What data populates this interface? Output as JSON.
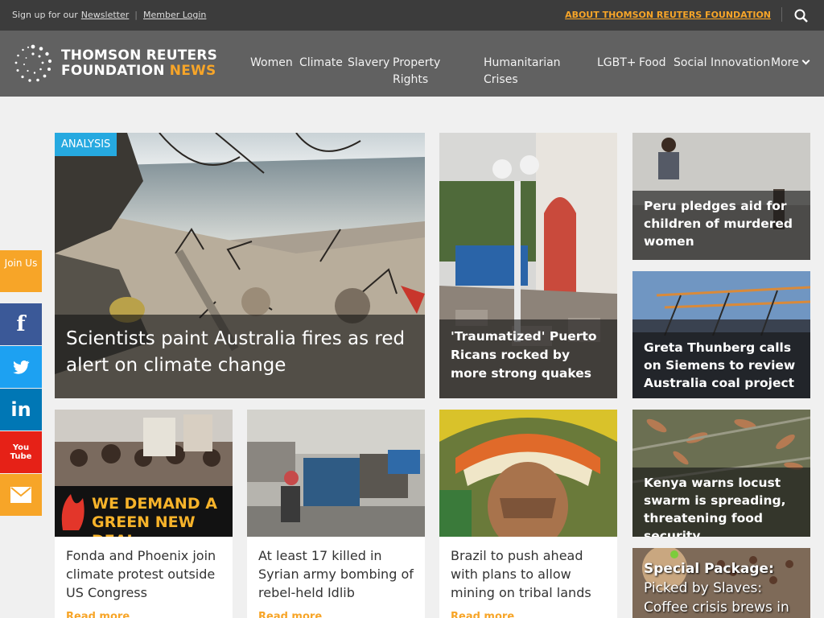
{
  "topbar": {
    "signup_text": "Sign up for our",
    "newsletter": "Newsletter",
    "member_login": "Member Login",
    "about": "ABOUT THOMSON REUTERS FOUNDATION"
  },
  "header": {
    "logo_line1": "THOMSON REUTERS",
    "logo_line2": "FOUNDATION",
    "logo_news": "NEWS",
    "nav": {
      "women": "Women",
      "climate": "Climate",
      "slavery": "Slavery",
      "property_rights": "Property Rights",
      "humanitarian": "Humanitarian Crises",
      "lgbt": "LGBT+",
      "food": "Food",
      "social_innovation": "Social Innovation",
      "more": "More"
    }
  },
  "hero": {
    "badge": "ANALYSIS",
    "title": "Scientists paint Australia fires as red alert on climate change"
  },
  "stories": {
    "puerto_rico": "'Traumatized' Puerto Ricans rocked by more strong quakes",
    "peru": "Peru pledges aid for children of murdered women",
    "greta": "Greta Thunberg calls on Siemens to review Australia coal project",
    "fonda": "Fonda and Phoenix join climate protest outside US Congress",
    "syria": "At least 17 killed in Syrian army bombing of rebel-held Idlib",
    "brazil": "Brazil to push ahead with plans to allow mining on tribal lands",
    "kenya": "Kenya warns locust swarm is spreading, threatening food security",
    "special_label": "Special Package:",
    "special_title": "Picked by Slaves: Coffee crisis brews in"
  },
  "read_more": "Read more",
  "protest_sign": "WE DEMAND A GREEN NEW DEAL",
  "sidebar": {
    "join": "Join Us",
    "facebook": "f",
    "twitter": "twitter-icon",
    "linkedin": "in",
    "youtube": "You Tube",
    "email": "email-icon"
  },
  "colors": {
    "accent_orange": "#f7a528",
    "badge_blue": "#26a9e0",
    "facebook": "#3b5998",
    "twitter": "#1da1f2",
    "linkedin": "#0077b5",
    "youtube": "#e62117"
  }
}
